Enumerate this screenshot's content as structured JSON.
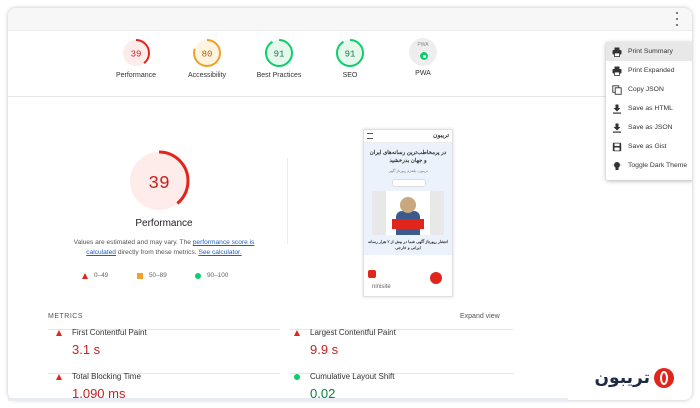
{
  "toolbar": {
    "menu_icon": "more-vert-icon"
  },
  "scores": [
    {
      "label": "Performance",
      "score": 39,
      "color": "#e1251b",
      "bg": "#fdecea",
      "text_color": "#c7221f"
    },
    {
      "label": "Accessibility",
      "score": 80,
      "color": "#f0a12a",
      "bg": "#fff4e0",
      "text_color": "#b35e00"
    },
    {
      "label": "Best Practices",
      "score": 91,
      "color": "#0cce6b",
      "bg": "#e6f7ee",
      "text_color": "#0a7d3e"
    },
    {
      "label": "SEO",
      "score": 91,
      "color": "#0cce6b",
      "bg": "#e6f7ee",
      "text_color": "#0a7d3e"
    },
    {
      "label": "PWA",
      "badge_text": "PWA",
      "icon": "pwa-badge-icon"
    }
  ],
  "performance": {
    "score": 39,
    "title": "Performance",
    "desc_prefix": "Values are estimated and may vary. The ",
    "desc_link1": "performance score is calculated",
    "desc_mid": " directly from these metrics. ",
    "desc_link2": "See calculator."
  },
  "legend": [
    {
      "shape": "triangle",
      "range": "0–49"
    },
    {
      "shape": "square",
      "range": "50–89"
    },
    {
      "shape": "circle",
      "range": "90–100"
    }
  ],
  "screenshot": {
    "logo_text": "تریبون",
    "headline": "در پرمخاطب‌ترین رسانه‌های ایران و جهان بدرخشید",
    "subtext": "تریبون، پلتفرم رپورتاژ آگهی",
    "bottom_text": "انتشار رپورتاژ آگهی شما در بیش از ۲ هزار رسانه ایرانی و خارجی",
    "footer_text": "ninisite"
  },
  "metrics": {
    "header": "METRICS",
    "expand_label": "Expand view",
    "items": [
      {
        "label": "First Contentful Paint",
        "value": "3.1 s",
        "status": "fail"
      },
      {
        "label": "Largest Contentful Paint",
        "value": "9.9 s",
        "status": "fail"
      },
      {
        "label": "Total Blocking Time",
        "value": "1,090 ms",
        "status": "fail"
      },
      {
        "label": "Cumulative Layout Shift",
        "value": "0.02",
        "status": "pass"
      }
    ]
  },
  "menu": {
    "items": [
      {
        "label": "Print Summary",
        "icon": "printer-icon",
        "active": true
      },
      {
        "label": "Print Expanded",
        "icon": "printer-icon"
      },
      {
        "label": "Copy JSON",
        "icon": "copy-icon"
      },
      {
        "label": "Save as HTML",
        "icon": "download-icon"
      },
      {
        "label": "Save as JSON",
        "icon": "download-icon"
      },
      {
        "label": "Save as Gist",
        "icon": "save-icon"
      },
      {
        "label": "Toggle Dark Theme",
        "icon": "lightbulb-icon"
      }
    ]
  },
  "brand": {
    "text": "تریبون"
  },
  "colors": {
    "fail": "#e1251b",
    "average": "#f0a12a",
    "pass": "#0cce6b",
    "link": "#1a5fc7"
  }
}
